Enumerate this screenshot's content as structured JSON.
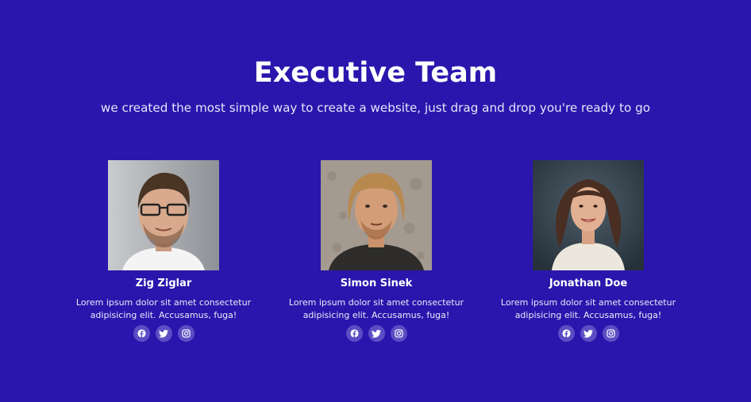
{
  "header": {
    "title": "Executive Team",
    "subtitle": "we created the most simple way to create a website, just drag and drop you're ready to go"
  },
  "team": [
    {
      "name": "Zig Ziglar",
      "bio": "Lorem ipsum dolor sit amet consectetur adipisicing elit. Accusamus, fuga!"
    },
    {
      "name": "Simon Sinek",
      "bio": "Lorem ipsum dolor sit amet consectetur adipisicing elit. Accusamus, fuga!"
    },
    {
      "name": "Jonathan Doe",
      "bio": "Lorem ipsum dolor sit amet consectetur adipisicing elit. Accusamus, fuga!"
    }
  ],
  "social_icons": [
    "facebook-icon",
    "twitter-icon",
    "instagram-icon"
  ],
  "colors": {
    "background": "#2a16ad",
    "icon_circle": "#5b4ec4",
    "text": "#ffffff"
  }
}
